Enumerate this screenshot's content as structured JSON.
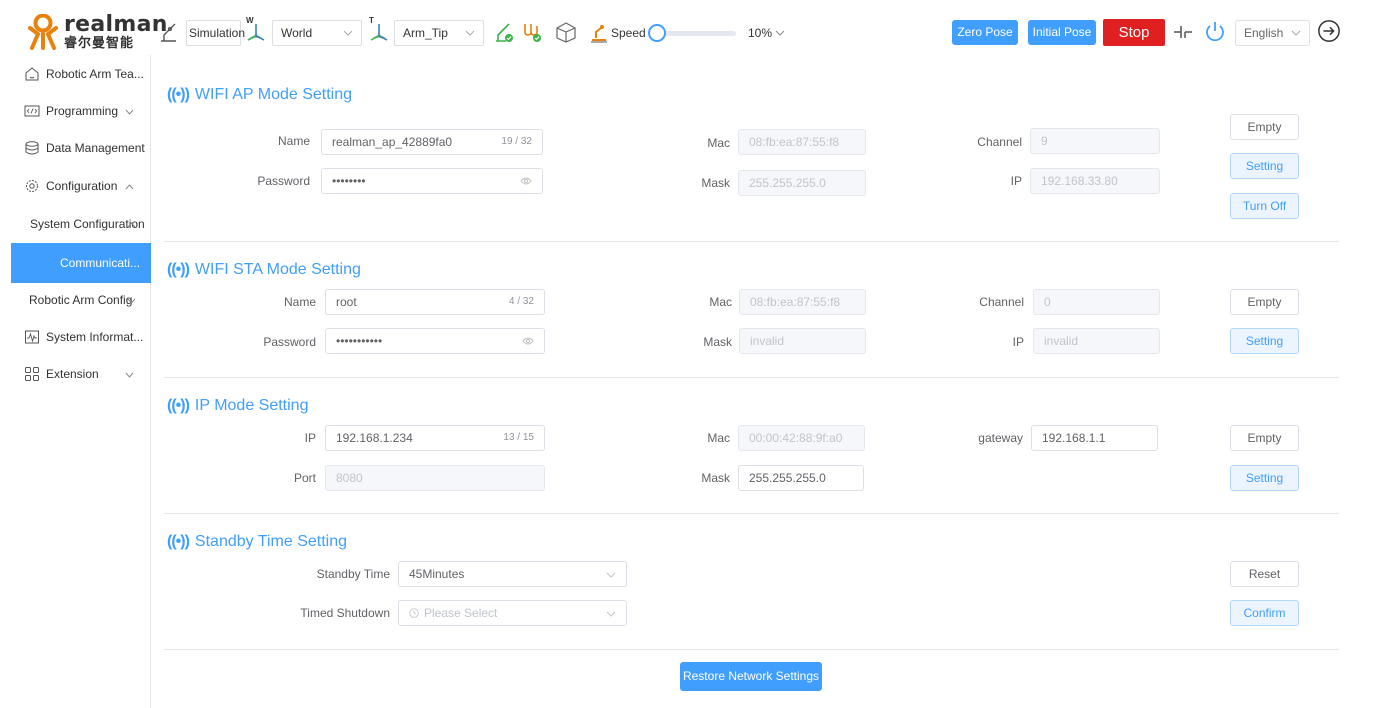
{
  "brand": {
    "name": "realman",
    "name_cn": "睿尔曼智能",
    "color": "#e8820c"
  },
  "toolbar": {
    "mode_label": "Simulation",
    "frame_sup": "W",
    "frame_value": "World",
    "tool_sup": "T",
    "tool_value": "Arm_Tip",
    "speed_label": "Speed",
    "speed_value": "10%",
    "speed_fraction": 0.1,
    "zero_pose_label": "Zero Pose",
    "initial_pose_label": "Initial Pose",
    "stop_label": "Stop",
    "language_value": "English",
    "icons": [
      "robot-arm-icon",
      "base-frame-icon",
      "tool-frame-icon",
      "arm-status-icon",
      "gripper-status-icon",
      "cube-icon",
      "teach-icon",
      "collision-icon",
      "power-icon",
      "logout-icon"
    ]
  },
  "colors": {
    "accent": "#409eff",
    "stop": "#e02020",
    "active_bg": "#409eff",
    "ok_green": "#3cb34a"
  },
  "sidebar": {
    "items": [
      {
        "label": "Robotic Arm Tea...",
        "icon": "home-icon"
      },
      {
        "label": "Programming",
        "icon": "code-icon"
      },
      {
        "label": "Data Management",
        "icon": "database-icon"
      },
      {
        "label": "Configuration",
        "icon": "config-icon"
      },
      {
        "label": "System Configuration"
      },
      {
        "label": "Communicati..."
      },
      {
        "label": "Robotic Arm Config"
      },
      {
        "label": "System Informat...",
        "icon": "monitor-icon"
      },
      {
        "label": "Extension",
        "icon": "grid-icon"
      }
    ]
  },
  "ap": {
    "title": "WIFI AP Mode Setting",
    "name_label": "Name",
    "name_value": "realman_ap_42889fa0",
    "name_count": "19 / 32",
    "password_label": "Password",
    "password_value": "••••••••",
    "mac_label": "Mac",
    "mac_value": "08:fb:ea:87:55:f8",
    "mask_label": "Mask",
    "mask_value": "255.255.255.0",
    "channel_label": "Channel",
    "channel_value": "9",
    "ip_label": "IP",
    "ip_value": "192.168.33.80",
    "empty_label": "Empty",
    "setting_label": "Setting",
    "turnoff_label": "Turn Off"
  },
  "sta": {
    "title": "WIFI STA Mode Setting",
    "name_label": "Name",
    "name_value": "root",
    "name_count": "4 / 32",
    "password_label": "Password",
    "password_value": "•••••••••••",
    "mac_label": "Mac",
    "mac_value": "08:fb:ea:87:55:f8",
    "mask_label": "Mask",
    "mask_value": "invalid",
    "channel_label": "Channel",
    "channel_value": "0",
    "ip_label": "IP",
    "ip_value": "invalid",
    "empty_label": "Empty",
    "setting_label": "Setting"
  },
  "ipmode": {
    "title": "IP Mode Setting",
    "ip_label": "IP",
    "ip_value": "192.168.1.234",
    "ip_count": "13 / 15",
    "port_label": "Port",
    "port_value": "8080",
    "mac_label": "Mac",
    "mac_value": "00:00:42:88:9f:a0",
    "mask_label": "Mask",
    "mask_value": "255.255.255.0",
    "gateway_label": "gateway",
    "gateway_value": "192.168.1.1",
    "empty_label": "Empty",
    "setting_label": "Setting"
  },
  "standby": {
    "title": "Standby Time Setting",
    "time_label": "Standby Time",
    "time_value": "45Minutes",
    "shutdown_label": "Timed Shutdown",
    "shutdown_placeholder": "Please Select",
    "reset_label": "Reset",
    "confirm_label": "Confirm"
  },
  "footer": {
    "restore_label": "Restore Network Settings"
  }
}
